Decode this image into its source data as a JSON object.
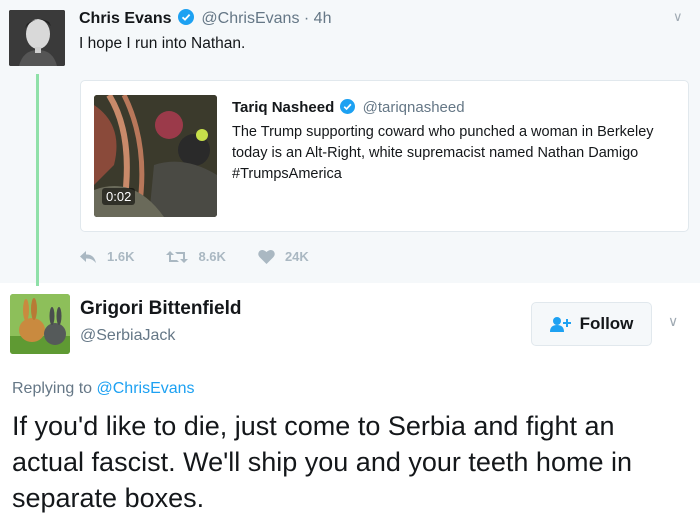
{
  "original_tweet": {
    "name": "Chris Evans",
    "handle": "@ChrisEvans",
    "time": "· 4h",
    "text": "I hope I run into Nathan.",
    "verified": true,
    "avatar_icon": "profile-photo"
  },
  "quoted_tweet": {
    "name": "Tariq Nasheed",
    "handle": "@tariqnasheed",
    "text": "The Trump supporting coward who punched a woman in Berkeley today is an Alt-Right, white supremacist named Nathan Damigo #TrumpsAmerica",
    "video_duration": "0:02",
    "verified": true
  },
  "actions": {
    "reply_count": "1.6K",
    "retweet_count": "8.6K",
    "like_count": "24K"
  },
  "reply_tweet": {
    "name": "Grigori Bittenfield",
    "handle": "@SerbiaJack",
    "follow_label": "Follow",
    "replying_to_prefix": "Replying to",
    "replying_to_handle": "@ChrisEvans",
    "text": "If you'd like to die, just come to Serbia and fight an actual fascist. We'll ship you and your teeth home in separate boxes."
  },
  "colors": {
    "verified_blue": "#1da1f2",
    "thread_line": "#8fe0a8",
    "link": "#1da1f2"
  }
}
